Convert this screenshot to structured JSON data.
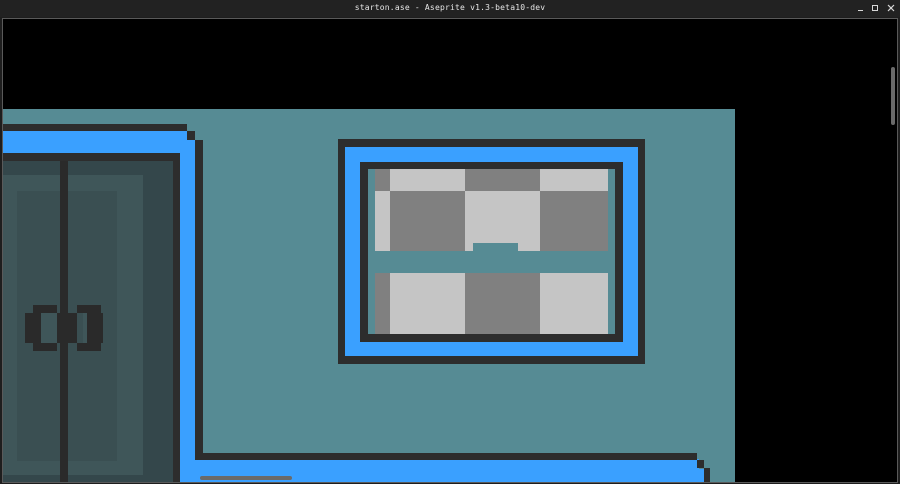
{
  "window": {
    "title": "starton.ase - Aseprite v1.3-beta10-dev",
    "minimize_glyph": "▫",
    "maximize_glyph": "▫",
    "close_glyph": "✕"
  },
  "colors": {
    "background": "#000000",
    "wall": "#568b94",
    "outline": "#2d2d2d",
    "trim_blue": "#3aa0ff",
    "door_dark": "#34474b",
    "door_mid": "#3f5659",
    "checker_light": "#c5c5c5",
    "checker_dark": "#808080"
  },
  "icons": [
    "minimize-icon",
    "maximize-icon",
    "close-icon"
  ]
}
